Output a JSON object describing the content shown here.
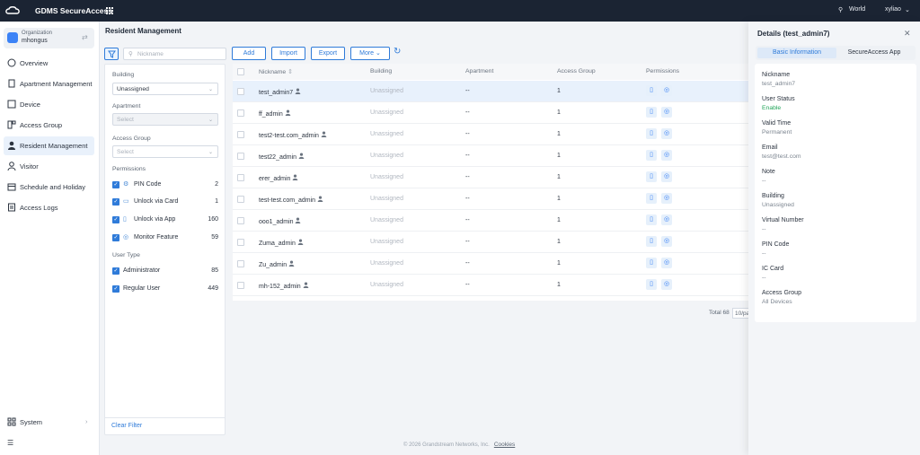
{
  "app": {
    "title": "GDMS SecureAccess",
    "location": "World",
    "user": "xyliao"
  },
  "org": {
    "label": "Organization",
    "name": "mhongus"
  },
  "nav": [
    {
      "label": "Overview",
      "icon": "overview-icon"
    },
    {
      "label": "Apartment Management",
      "icon": "apartment-icon"
    },
    {
      "label": "Device",
      "icon": "device-icon"
    },
    {
      "label": "Access Group",
      "icon": "access-group-icon"
    },
    {
      "label": "Resident Management",
      "icon": "resident-icon"
    },
    {
      "label": "Visitor",
      "icon": "visitor-icon"
    },
    {
      "label": "Schedule and Holiday",
      "icon": "calendar-icon"
    },
    {
      "label": "Access Logs",
      "icon": "logs-icon"
    }
  ],
  "system": {
    "label": "System"
  },
  "page": {
    "title": "Resident Management"
  },
  "search": {
    "placeholder": "Nickname"
  },
  "toolbar": {
    "add": "Add",
    "import": "Import",
    "export": "Export",
    "more": "More"
  },
  "filters": {
    "building_label": "Building",
    "building_value": "Unassigned",
    "apartment_label": "Apartment",
    "apartment_placeholder": "Select",
    "access_group_label": "Access Group",
    "access_group_placeholder": "Select",
    "permissions_label": "Permissions",
    "permissions": [
      {
        "label": "PIN Code",
        "count": "2"
      },
      {
        "label": "Unlock via Card",
        "count": "1"
      },
      {
        "label": "Unlock via App",
        "count": "160"
      },
      {
        "label": "Monitor Feature",
        "count": "59"
      }
    ],
    "user_type_label": "User Type",
    "user_types": [
      {
        "label": "Administrator",
        "count": "85"
      },
      {
        "label": "Regular User",
        "count": "449"
      }
    ],
    "clear": "Clear Filter"
  },
  "table": {
    "columns": {
      "nickname": "Nickname",
      "building": "Building",
      "apartment": "Apartment",
      "access_group": "Access Group",
      "permissions": "Permissions"
    },
    "rows": [
      {
        "nickname": "test_admin7",
        "building": "Unassigned",
        "apartment": "--",
        "access_group": "1"
      },
      {
        "nickname": "ff_admin",
        "building": "Unassigned",
        "apartment": "--",
        "access_group": "1"
      },
      {
        "nickname": "test2-test.com_admin",
        "building": "Unassigned",
        "apartment": "--",
        "access_group": "1"
      },
      {
        "nickname": "test22_admin",
        "building": "Unassigned",
        "apartment": "--",
        "access_group": "1"
      },
      {
        "nickname": "erer_admin",
        "building": "Unassigned",
        "apartment": "--",
        "access_group": "1"
      },
      {
        "nickname": "test-test.com_admin",
        "building": "Unassigned",
        "apartment": "--",
        "access_group": "1"
      },
      {
        "nickname": "ooo1_admin",
        "building": "Unassigned",
        "apartment": "--",
        "access_group": "1"
      },
      {
        "nickname": "Zuma_admin",
        "building": "Unassigned",
        "apartment": "--",
        "access_group": "1"
      },
      {
        "nickname": "Zu_admin",
        "building": "Unassigned",
        "apartment": "--",
        "access_group": "1"
      },
      {
        "nickname": "mh-152_admin",
        "building": "Unassigned",
        "apartment": "--",
        "access_group": "1"
      }
    ]
  },
  "pagination": {
    "total": "Total 68",
    "page_size": "10/pa"
  },
  "footer": {
    "copyright": "© 2026 Grandstream Networks, Inc.",
    "cookies": "Cookies"
  },
  "details": {
    "title": "Details (test_admin7)",
    "tabs": [
      "Basic Information",
      "SecureAccess App"
    ],
    "fields": [
      {
        "label": "Nickname",
        "value": "test_admin7"
      },
      {
        "label": "User Status",
        "value": "Enable"
      },
      {
        "label": "Valid Time",
        "value": "Permanent"
      },
      {
        "label": "Email",
        "value": "test@test.com"
      },
      {
        "label": "Note",
        "value": "--"
      },
      {
        "label": "Building",
        "value": "Unassigned"
      },
      {
        "label": "Virtual Number",
        "value": "--"
      },
      {
        "label": "PIN Code",
        "value": "--"
      },
      {
        "label": "IC Card",
        "value": "--"
      },
      {
        "label": "Access Group",
        "value": "All Devices"
      }
    ]
  },
  "colors": {
    "accent": "#2f7bd9",
    "topbar": "#1b2433",
    "status_enable": "#22a55a"
  }
}
